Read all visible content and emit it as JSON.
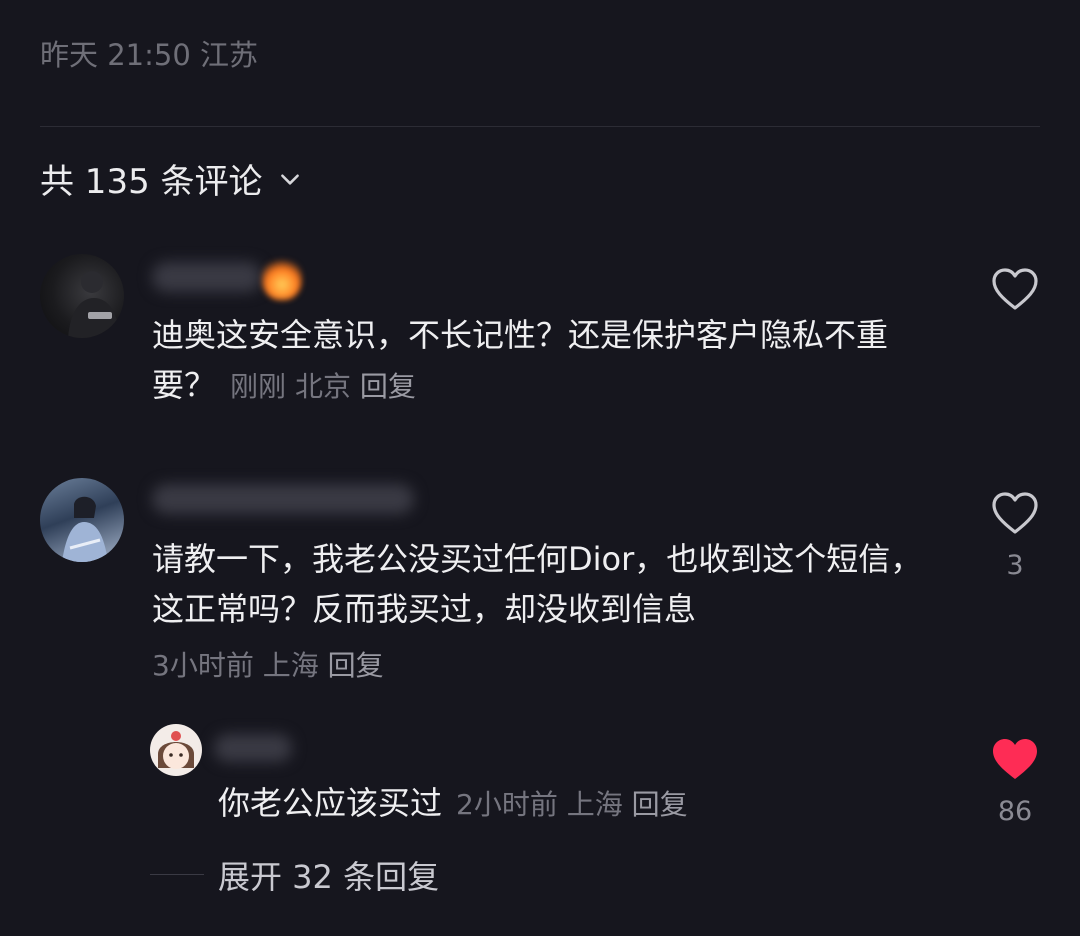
{
  "post": {
    "meta": "昨天 21:50 江苏"
  },
  "comments_header": {
    "label": "共 135 条评论"
  },
  "comments": [
    {
      "text": "迪奥这安全意识，不长记性？还是保护客户隐私不重要？",
      "time": "刚刚",
      "location": "北京",
      "reply_label": "回复",
      "likes": ""
    },
    {
      "text": "请教一下，我老公没买过任何Dior，也收到这个短信，这正常吗？反而我买过，却没收到信息",
      "time": "3小时前",
      "location": "上海",
      "reply_label": "回复",
      "likes": "3"
    }
  ],
  "reply": {
    "text": "你老公应该买过",
    "time": "2小时前",
    "location": "上海",
    "reply_label": "回复",
    "likes": "86",
    "liked": true
  },
  "expand": {
    "label": "展开 32 条回复"
  },
  "colors": {
    "background": "#16161e",
    "liked_heart": "#fe2c55",
    "muted_text": "#75757f"
  }
}
